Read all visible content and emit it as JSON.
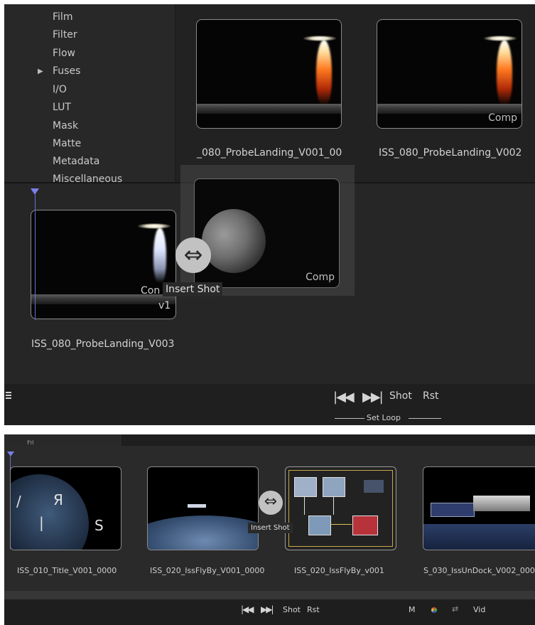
{
  "panel_top": {
    "categories": [
      {
        "label": "Film",
        "expandable": false
      },
      {
        "label": "Filter",
        "expandable": false
      },
      {
        "label": "Flow",
        "expandable": false
      },
      {
        "label": "Fuses",
        "expandable": true
      },
      {
        "label": "I/O",
        "expandable": false
      },
      {
        "label": "LUT",
        "expandable": false
      },
      {
        "label": "Mask",
        "expandable": false
      },
      {
        "label": "Matte",
        "expandable": false
      },
      {
        "label": "Metadata",
        "expandable": false
      },
      {
        "label": "Miscellaneous",
        "expandable": false
      }
    ],
    "bin_items": [
      {
        "name": "_080_ProbeLanding_V001_00",
        "tag": ""
      },
      {
        "name": "ISS_080_ProbeLanding_V002",
        "tag": "Comp"
      }
    ],
    "dragged_clip": {
      "tag": "Comp"
    },
    "strip_clip": {
      "name": "ISS_080_ProbeLanding_V003",
      "tag": "Con",
      "version": "v1"
    },
    "insert_tooltip": "Insert Shot",
    "toolbar": {
      "shot_label": "Shot",
      "reset_label": "Rst",
      "set_loop_label": "Set Loop"
    }
  },
  "panel_bottom": {
    "top_label": "Fil",
    "clips": [
      {
        "name": "ISS_010_Title_V001_0000"
      },
      {
        "name": "ISS_020_IssFlyBy_V001_0000"
      },
      {
        "name": "ISS_020_IssFlyBy_v001"
      },
      {
        "name": "S_030_IssUnDock_V002_0000"
      }
    ],
    "insert_tooltip": "Insert Shot",
    "toolbar": {
      "shot_label": "Shot",
      "reset_label": "Rst",
      "m_label": "M",
      "vid_label": "Vid"
    }
  }
}
